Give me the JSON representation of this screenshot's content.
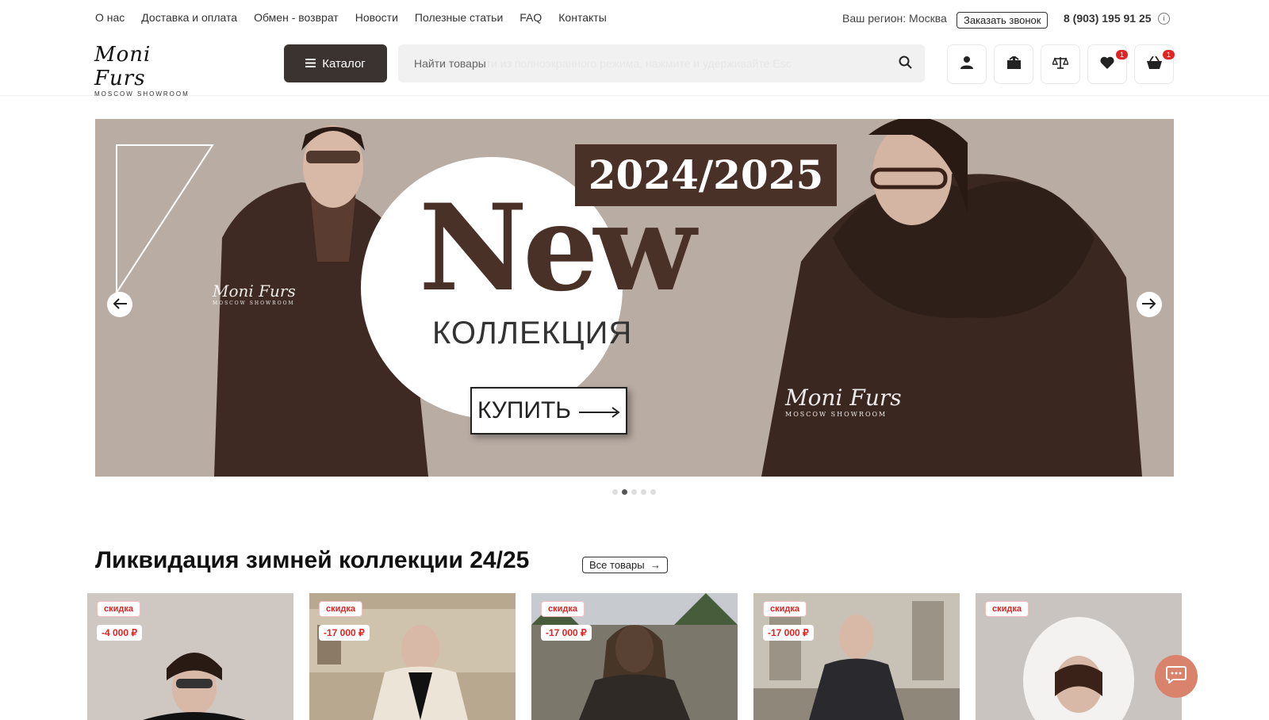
{
  "topnav": {
    "links": [
      "О нас",
      "Доставка и оплата",
      "Обмен - возврат",
      "Новости",
      "Полезные статьи",
      "FAQ",
      "Контакты"
    ],
    "region": "Ваш регион: Москва",
    "callback": "Заказать звонок",
    "phone": "8 (903) 195 91 25",
    "info_icon": "i"
  },
  "logo": {
    "script": "Moni Furs",
    "sub": "MOSCOW SHOWROOM"
  },
  "header": {
    "catalog_label": "Каталог",
    "search_placeholder": "Найти товары",
    "fullscreen_hint": "Чтобы выйти из полноэкранного режима, нажмите и удерживайте Esc",
    "wishlist_count": "1",
    "cart_count": "1"
  },
  "banner": {
    "year": "2024/2025",
    "headline": "New",
    "subhead": "КОЛЛЕКЦИЯ",
    "cta": "КУПИТЬ",
    "watermark": "Moni Furs",
    "watermark_sub": "MOSCOW SHOWROOM",
    "slides": 5,
    "active_slide": 2
  },
  "section": {
    "title": "Ликвидация зимней коллекции 24/25",
    "all_label": "Все товары"
  },
  "products": [
    {
      "tag": "скидка",
      "discount": "-4 000 ₽",
      "bg": "#cfc7c2"
    },
    {
      "tag": "скидка",
      "discount": "-17 000 ₽",
      "bg": "#b8a890"
    },
    {
      "tag": "скидка",
      "discount": "-17 000 ₽",
      "bg": "#7c776b"
    },
    {
      "tag": "скидка",
      "discount": "-17 000 ₽",
      "bg": "#8e877a"
    },
    {
      "tag": "скидка",
      "discount": "",
      "bg": "#c9c4bf"
    }
  ],
  "colors": {
    "dark_button": "#3b3330",
    "brand_brown": "#4a3128",
    "badge_red": "#e02424",
    "chat": "#d9826c"
  }
}
